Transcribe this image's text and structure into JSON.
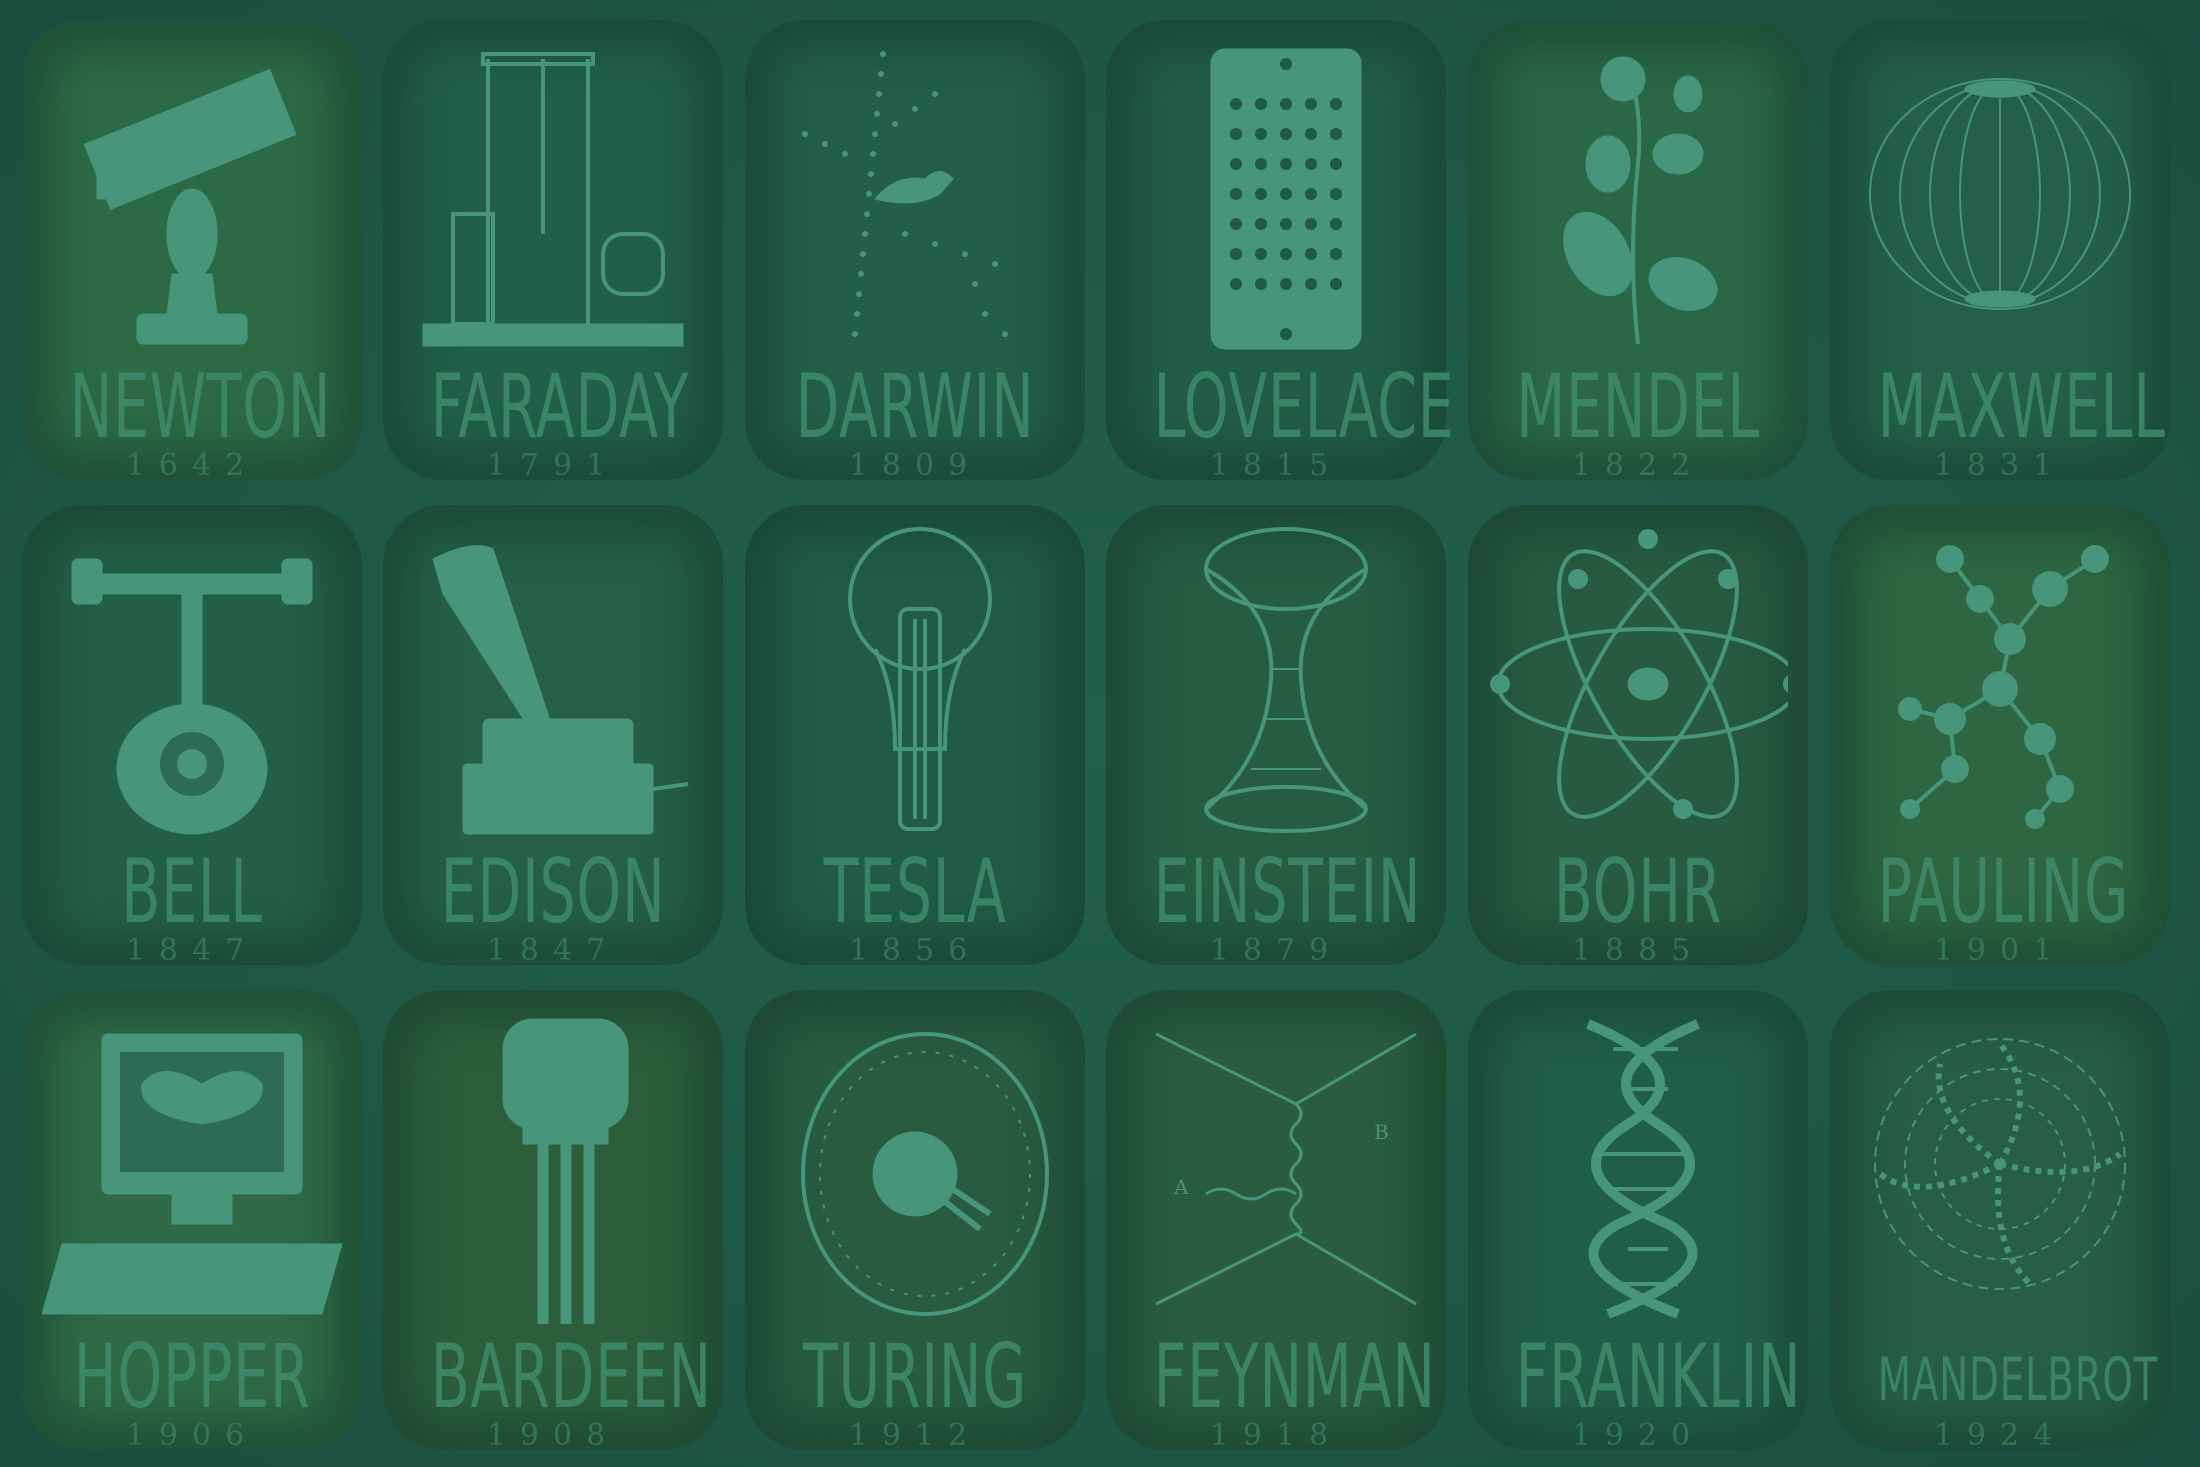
{
  "scientists": [
    {
      "name": "NEWTON",
      "year": "1642",
      "icon": "telescope-icon",
      "tone": "#2c6a45"
    },
    {
      "name": "FARADAY",
      "year": "1791",
      "icon": "apparatus-icon",
      "tone": "#215f4a"
    },
    {
      "name": "DARWIN",
      "year": "1809",
      "icon": "tree-bird-icon",
      "tone": "#225e49"
    },
    {
      "name": "LOVELACE",
      "year": "1815",
      "icon": "punchcard-icon",
      "tone": "#215c48"
    },
    {
      "name": "MENDEL",
      "year": "1822",
      "icon": "pea-plant-icon",
      "tone": "#2a6746"
    },
    {
      "name": "MAXWELL",
      "year": "1831",
      "icon": "field-lines-icon",
      "tone": "#235f49"
    },
    {
      "name": "BELL",
      "year": "1847",
      "icon": "telephone-icon",
      "tone": "#235e46"
    },
    {
      "name": "EDISON",
      "year": "1847",
      "icon": "phonograph-icon",
      "tone": "#245f46"
    },
    {
      "name": "TESLA",
      "year": "1856",
      "icon": "lightbulb-icon",
      "tone": "#205b47"
    },
    {
      "name": "EINSTEIN",
      "year": "1879",
      "icon": "spacetime-icon",
      "tone": "#255c42"
    },
    {
      "name": "BOHR",
      "year": "1885",
      "icon": "atom-icon",
      "tone": "#275a40"
    },
    {
      "name": "PAULING",
      "year": "1901",
      "icon": "molecule-icon",
      "tone": "#2d6641"
    },
    {
      "name": "HOPPER",
      "year": "1906",
      "icon": "computer-moth-icon",
      "tone": "#2e6a45"
    },
    {
      "name": "BARDEEN",
      "year": "1908",
      "icon": "transistor-icon",
      "tone": "#2c5e3b"
    },
    {
      "name": "TURING",
      "year": "1912",
      "icon": "enigma-rotor-icon",
      "tone": "#285b40"
    },
    {
      "name": "FEYNMAN",
      "year": "1918",
      "icon": "feynman-diagram-icon",
      "tone": "#2a5d3f"
    },
    {
      "name": "FRANKLIN",
      "year": "1920",
      "icon": "dna-icon",
      "tone": "#215e49"
    },
    {
      "name": "MANDELBROT",
      "year": "1924",
      "icon": "fractal-icon",
      "tone": "#265e46"
    }
  ],
  "labels": {
    "feynman_a": "A",
    "feynman_b": "B"
  }
}
